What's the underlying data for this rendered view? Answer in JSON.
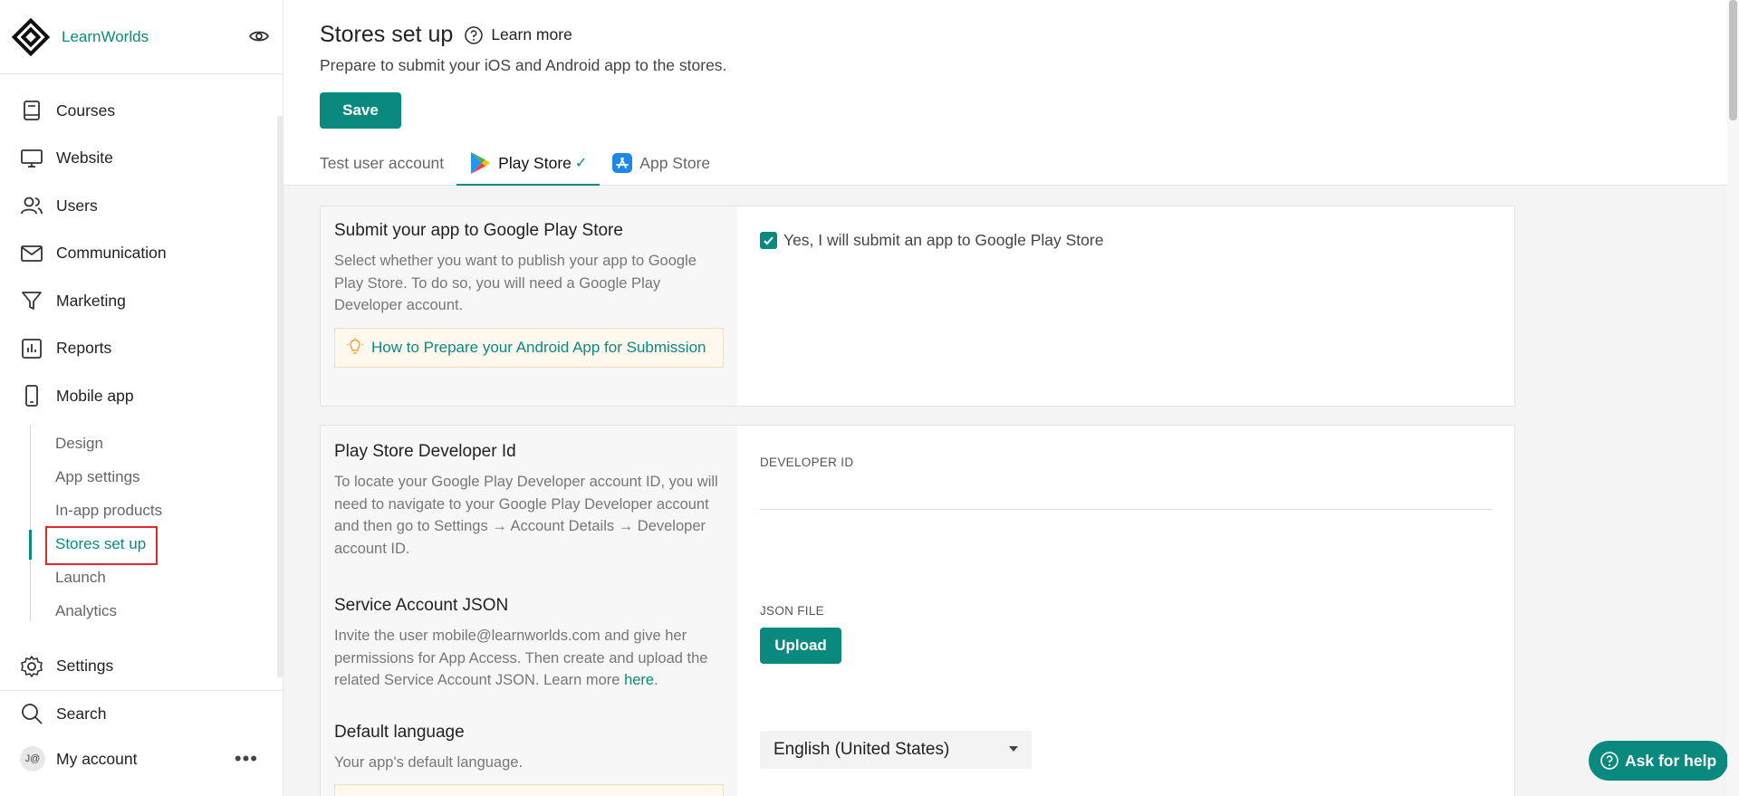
{
  "brand": {
    "name": "LearnWorlds"
  },
  "nav": {
    "items": [
      {
        "label": "Courses",
        "icon": "book-icon"
      },
      {
        "label": "Website",
        "icon": "monitor-icon"
      },
      {
        "label": "Users",
        "icon": "users-icon"
      },
      {
        "label": "Communication",
        "icon": "mail-icon"
      },
      {
        "label": "Marketing",
        "icon": "funnel-icon"
      },
      {
        "label": "Reports",
        "icon": "bar-chart-icon"
      },
      {
        "label": "Mobile app",
        "icon": "phone-icon"
      }
    ],
    "subitems": [
      "Design",
      "App settings",
      "In-app products",
      "Stores set up",
      "Launch",
      "Analytics"
    ],
    "settings": "Settings",
    "search": "Search",
    "account": "My account",
    "avatar": "J@"
  },
  "header": {
    "title": "Stores set up",
    "learn_more": "Learn more",
    "subtitle": "Prepare to submit your iOS and Android app to the stores.",
    "save": "Save"
  },
  "tabs": {
    "test_user": "Test user account",
    "play_store": "Play Store",
    "app_store": "App Store"
  },
  "submit_card": {
    "title": "Submit your app to Google Play Store",
    "desc": "Select whether you want to publish your app to Google Play Store. To do so, you will need a Google Play Developer account.",
    "tip_link": "How to Prepare your Android App for Submission",
    "checkbox_label": "Yes, I will submit an app to Google Play Store"
  },
  "dev_card": {
    "dev_title": "Play Store Developer Id",
    "dev_desc": "To locate your Google Play Developer account ID, you will need to navigate to your Google Play Developer account and then go to Settings → Account Details → Developer account ID.",
    "dev_field_label": "DEVELOPER ID",
    "json_title": "Service Account JSON",
    "json_desc": "Invite the user mobile@learnworlds.com and give her permissions for App Access. Then create and upload the related Service Account JSON. Learn more ",
    "json_link": "here",
    "json_field_label": "JSON FILE",
    "upload": "Upload",
    "lang_title": "Default language",
    "lang_desc": "Your app's default language.",
    "lang_value": "English (United States)"
  },
  "help": {
    "label": "Ask for help"
  },
  "colors": {
    "accent": "#0a8a7f",
    "highlight": "#e0292c"
  }
}
